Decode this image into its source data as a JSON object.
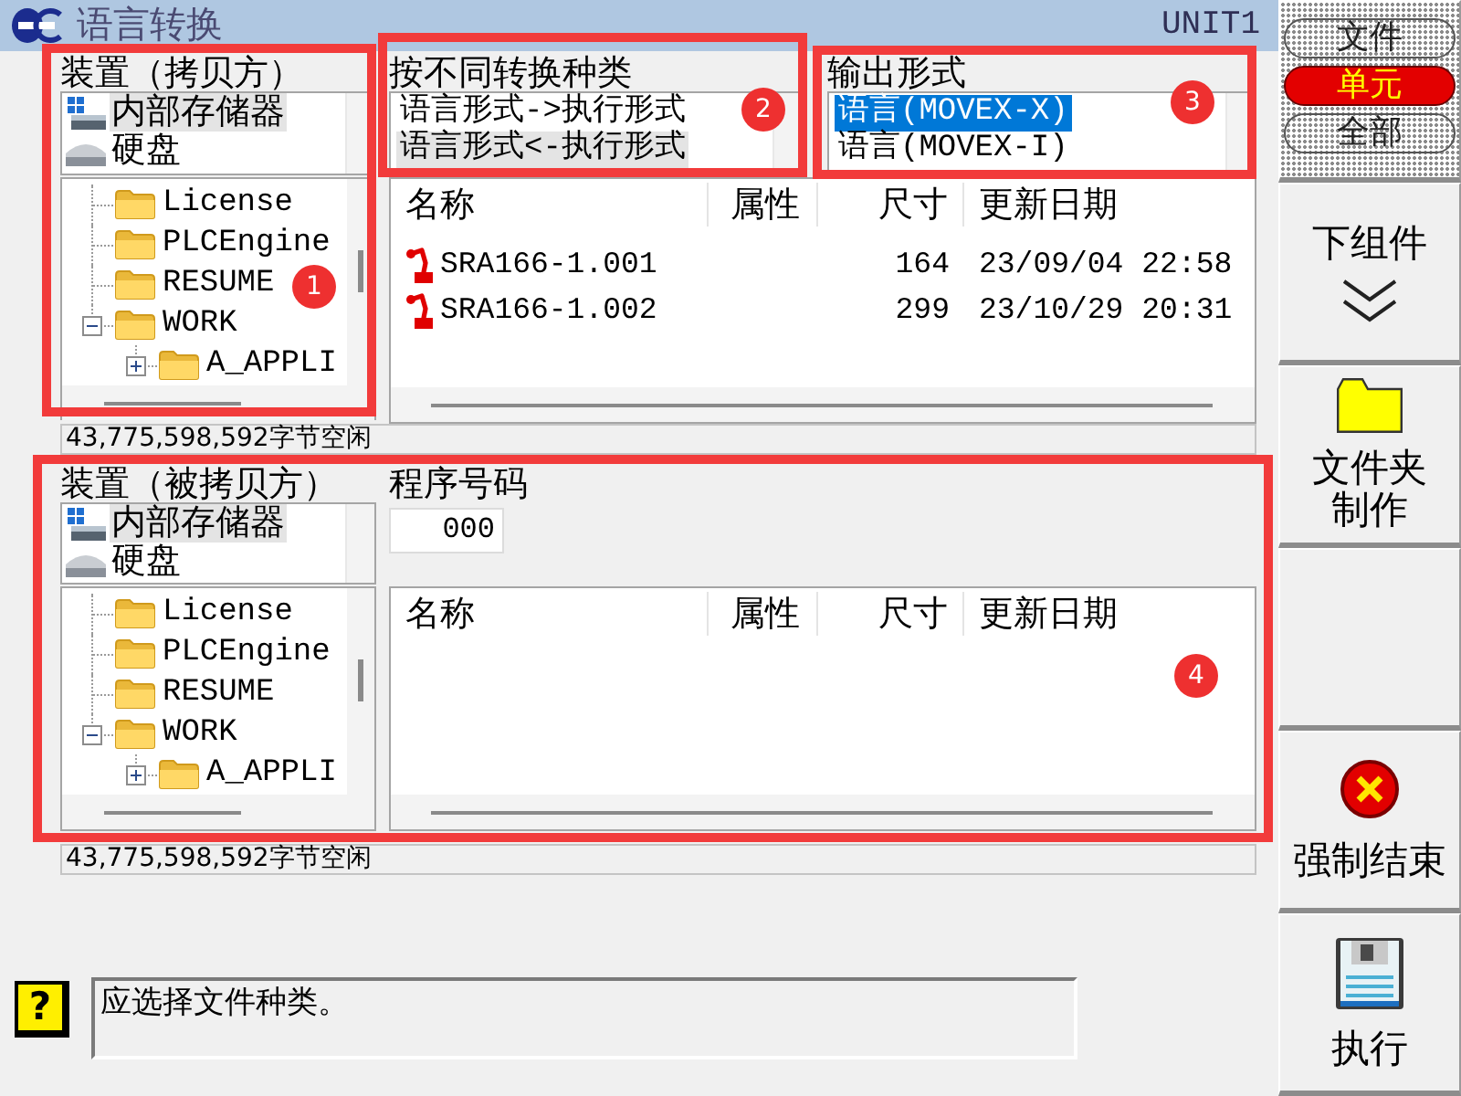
{
  "window": {
    "title": "语言转换",
    "unit": "UNIT1"
  },
  "source": {
    "label": "装置（拷贝方）",
    "device_list": {
      "focused": false,
      "items": [
        {
          "name": "内部存储器",
          "kind": "memory",
          "selected": true
        },
        {
          "name": "硬盘",
          "kind": "disk",
          "selected": false
        }
      ]
    },
    "tree": [
      {
        "name": "License"
      },
      {
        "name": "PLCEngine"
      },
      {
        "name": "RESUME"
      },
      {
        "name": "WORK",
        "expanded": true,
        "children": [
          {
            "name": "A_APPLI",
            "expanded": false
          }
        ]
      }
    ]
  },
  "conversion": {
    "label": "按不同转换种类",
    "focused": false,
    "options": [
      {
        "label": "语言形式->执行形式",
        "selected": false
      },
      {
        "label": "语言形式<-执行形式",
        "selected": true
      }
    ]
  },
  "output_format": {
    "label": "输出形式",
    "focused": true,
    "options": [
      {
        "label": "语言(MOVEX-X)",
        "selected": true
      },
      {
        "label": "语言(MOVEX-I)",
        "selected": false
      }
    ]
  },
  "source_files": {
    "columns": [
      "名称",
      "属性",
      "尺寸",
      "更新日期"
    ],
    "rows": [
      {
        "name": "SRA166-1.001",
        "size": "164",
        "updated": "23/09/04 22:58"
      },
      {
        "name": "SRA166-1.002",
        "size": "299",
        "updated": "23/10/29 20:31"
      }
    ]
  },
  "source_free_space": "43,775,598,592字节空闲",
  "target": {
    "label": "装置（被拷贝方）",
    "device_list": {
      "focused": false,
      "items": [
        {
          "name": "内部存储器",
          "kind": "memory",
          "selected": true
        },
        {
          "name": "硬盘",
          "kind": "disk",
          "selected": false
        }
      ]
    },
    "tree": [
      {
        "name": "License"
      },
      {
        "name": "PLCEngine"
      },
      {
        "name": "RESUME"
      },
      {
        "name": "WORK",
        "expanded": true,
        "children": [
          {
            "name": "A_APPLI",
            "expanded": false
          }
        ]
      }
    ]
  },
  "program_number": {
    "label": "程序号码",
    "value": "000"
  },
  "target_files": {
    "columns": [
      "名称",
      "属性",
      "尺寸",
      "更新日期"
    ]
  },
  "target_free_space": "43,775,598,592字节空闲",
  "message": {
    "glyph": "?",
    "text": "应选择文件种类。"
  },
  "sidebar": {
    "filter": [
      {
        "label": "文件",
        "selected": false
      },
      {
        "label": "单元",
        "selected": true
      },
      {
        "label": "全部",
        "selected": false
      }
    ],
    "buttons": [
      {
        "kind": "down",
        "label": "下组件"
      },
      {
        "kind": "folder",
        "label": "文件夹制作"
      },
      {
        "kind": "blank"
      },
      {
        "kind": "stop",
        "label": "强制结束"
      },
      {
        "kind": "run",
        "label": "执行"
      }
    ]
  },
  "annotations": [
    {
      "label": "1"
    },
    {
      "label": "2"
    },
    {
      "label": "3"
    },
    {
      "label": "4"
    }
  ]
}
